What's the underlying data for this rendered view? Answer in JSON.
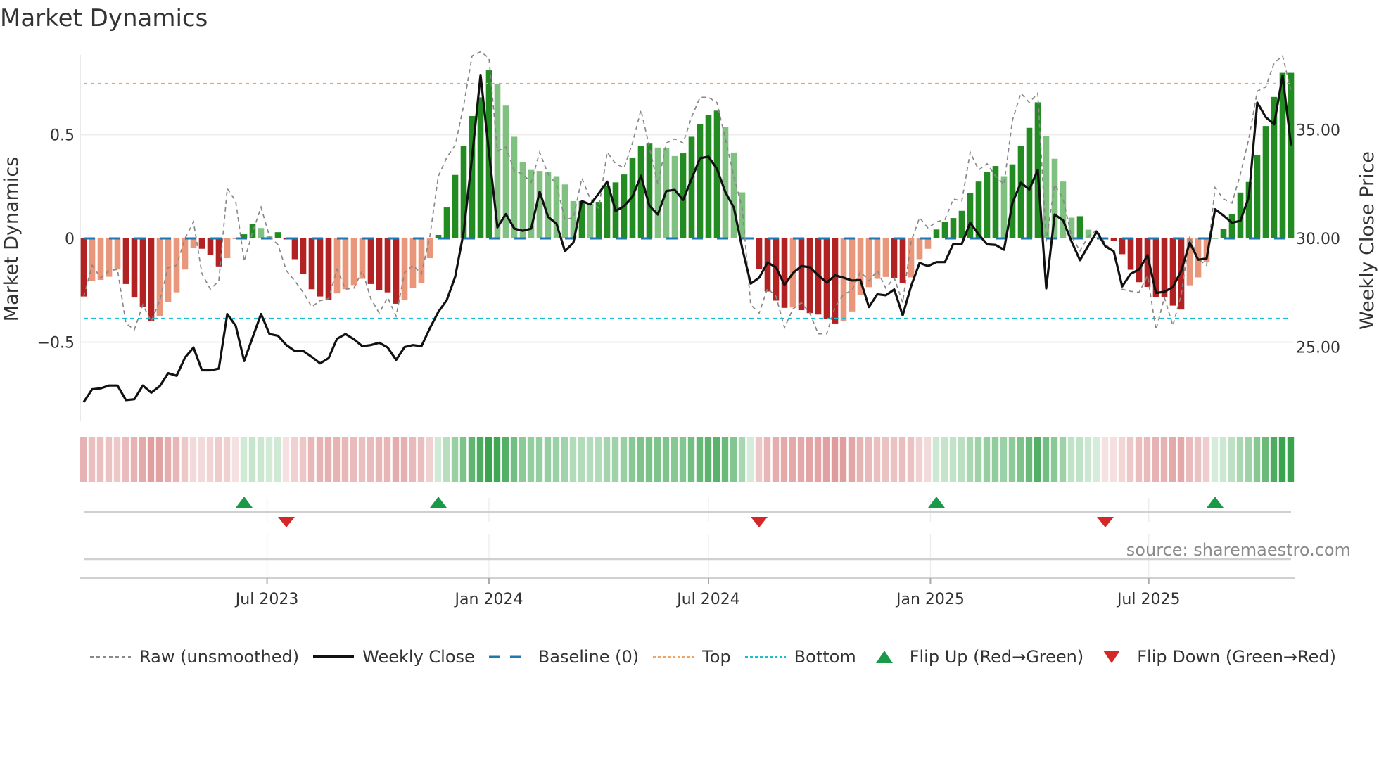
{
  "title": "Market Dynamics",
  "source": "source: sharemaestro.com",
  "colors": {
    "dark_green": "#228b22",
    "light_green": "#80c080",
    "dark_red": "#b22222",
    "light_red": "#e9967a",
    "raw": "#888888",
    "close": "#111111",
    "baseline": "#1f77b4",
    "top": "#f4a460",
    "bottom": "#17becf",
    "flip_up": "#1a9a48",
    "flip_down": "#d62728"
  },
  "legend": [
    {
      "key": "raw",
      "label": "Raw (unsmoothed)"
    },
    {
      "key": "close",
      "label": "Weekly Close"
    },
    {
      "key": "baseline",
      "label": "Baseline (0)"
    },
    {
      "key": "top",
      "label": "Top"
    },
    {
      "key": "bottom",
      "label": "Bottom"
    },
    {
      "key": "flip_up",
      "label": "Flip Up (Red→Green)"
    },
    {
      "key": "flip_down",
      "label": "Flip Down (Green→Red)"
    }
  ],
  "chart_data": {
    "type": "bar",
    "title": "Market Dynamics",
    "ylabel": "Market Dynamics",
    "y2label": "Weekly Close Price",
    "x_start": "2023-01-30",
    "x_step_days": 7,
    "x_ticks": [
      {
        "label": "Jul 2023",
        "date": "2023-07-01"
      },
      {
        "label": "Jan 2024",
        "date": "2024-01-01"
      },
      {
        "label": "Jul 2024",
        "date": "2024-07-01"
      },
      {
        "label": "Jan 2025",
        "date": "2025-01-01"
      },
      {
        "label": "Jul 2025",
        "date": "2025-07-01"
      }
    ],
    "ylim": [
      -0.88,
      0.89
    ],
    "y_ticks": [
      {
        "value": 0.5,
        "label": "0.5"
      },
      {
        "value": 0,
        "label": "0"
      },
      {
        "value": -0.5,
        "label": "−0.5"
      }
    ],
    "y2_ticks": [
      {
        "value": 35,
        "label": "35.00"
      },
      {
        "value": 30,
        "label": "30.00"
      },
      {
        "value": 25,
        "label": "25.00"
      }
    ],
    "baseline": 0,
    "top": 0.746,
    "bottom": -0.386,
    "values": [
      -0.28,
      -0.205,
      -0.2,
      -0.185,
      -0.15,
      -0.22,
      -0.285,
      -0.33,
      -0.4,
      -0.375,
      -0.305,
      -0.26,
      -0.15,
      -0.045,
      -0.05,
      -0.08,
      -0.135,
      -0.095,
      -0.003,
      0.02,
      0.07,
      0.05,
      0.01,
      0.03,
      -0.005,
      -0.1,
      -0.17,
      -0.245,
      -0.28,
      -0.295,
      -0.265,
      -0.245,
      -0.225,
      -0.195,
      -0.22,
      -0.25,
      -0.26,
      -0.315,
      -0.295,
      -0.24,
      -0.215,
      -0.095,
      0.017,
      0.149,
      0.306,
      0.446,
      0.59,
      0.68,
      0.81,
      0.746,
      0.64,
      0.49,
      0.368,
      0.33,
      0.325,
      0.32,
      0.3,
      0.26,
      0.18,
      0.18,
      0.167,
      0.176,
      0.252,
      0.27,
      0.308,
      0.39,
      0.444,
      0.457,
      0.438,
      0.435,
      0.397,
      0.41,
      0.49,
      0.55,
      0.596,
      0.616,
      0.536,
      0.414,
      0.222,
      0.005,
      -0.149,
      -0.256,
      -0.3,
      -0.335,
      -0.333,
      -0.346,
      -0.36,
      -0.367,
      -0.39,
      -0.41,
      -0.4,
      -0.352,
      -0.273,
      -0.235,
      -0.195,
      -0.186,
      -0.19,
      -0.214,
      -0.188,
      -0.1,
      -0.05,
      0.043,
      0.079,
      0.098,
      0.133,
      0.218,
      0.274,
      0.32,
      0.349,
      0.3,
      0.357,
      0.446,
      0.533,
      0.656,
      0.494,
      0.384,
      0.274,
      0.1,
      0.107,
      0.042,
      0.005,
      -0.005,
      -0.011,
      -0.076,
      -0.151,
      -0.211,
      -0.234,
      -0.284,
      -0.284,
      -0.324,
      -0.343,
      -0.226,
      -0.188,
      -0.115,
      0.002,
      0.046,
      0.116,
      0.221,
      0.272,
      0.403,
      0.542,
      0.682,
      0.798,
      0.798
    ],
    "raw": [
      -0.28,
      -0.13,
      -0.19,
      -0.155,
      -0.15,
      -0.41,
      -0.44,
      -0.32,
      -0.4,
      -0.3,
      -0.14,
      -0.13,
      0.0,
      0.08,
      -0.17,
      -0.245,
      -0.205,
      0.24,
      0.18,
      -0.11,
      0.03,
      0.15,
      0.01,
      -0.03,
      -0.155,
      -0.205,
      -0.26,
      -0.33,
      -0.3,
      -0.29,
      -0.15,
      -0.245,
      -0.24,
      -0.155,
      -0.29,
      -0.36,
      -0.285,
      -0.375,
      -0.165,
      -0.13,
      -0.17,
      0.01,
      0.3,
      0.39,
      0.45,
      0.64,
      0.88,
      0.9,
      0.87,
      0.42,
      0.44,
      0.325,
      0.31,
      0.27,
      0.415,
      0.31,
      0.26,
      0.09,
      0.1,
      0.29,
      0.19,
      0.145,
      0.415,
      0.36,
      0.34,
      0.46,
      0.62,
      0.44,
      0.26,
      0.46,
      0.48,
      0.46,
      0.585,
      0.68,
      0.68,
      0.655,
      0.48,
      0.3,
      0.145,
      -0.32,
      -0.36,
      -0.24,
      -0.28,
      -0.43,
      -0.34,
      -0.31,
      -0.36,
      -0.46,
      -0.46,
      -0.33,
      -0.27,
      -0.25,
      -0.16,
      -0.205,
      -0.155,
      -0.24,
      -0.19,
      -0.31,
      -0.015,
      0.1,
      0.05,
      0.08,
      0.09,
      0.19,
      0.18,
      0.415,
      0.33,
      0.36,
      0.3,
      0.26,
      0.57,
      0.7,
      0.655,
      0.7,
      -0.015,
      0.26,
      0.19,
      0.01,
      -0.06,
      0.01,
      0.04,
      -0.025,
      -0.07,
      -0.245,
      -0.255,
      -0.26,
      -0.18,
      -0.44,
      -0.285,
      -0.42,
      -0.27,
      0.01,
      -0.1,
      -0.13,
      0.245,
      0.19,
      0.17,
      0.31,
      0.48,
      0.71,
      0.73,
      0.845,
      0.88,
      0.71
    ],
    "close": [
      22.47,
      23.06,
      23.1,
      23.23,
      23.23,
      22.56,
      22.6,
      23.23,
      22.9,
      23.2,
      23.8,
      23.68,
      24.52,
      24.98,
      23.93,
      23.93,
      24.01,
      26.52,
      25.98,
      24.36,
      25.44,
      26.52,
      25.6,
      25.52,
      25.09,
      24.82,
      24.82,
      24.55,
      24.25,
      24.49,
      25.38,
      25.6,
      25.36,
      25.04,
      25.09,
      25.2,
      24.98,
      24.41,
      25.0,
      25.09,
      25.04,
      25.87,
      26.62,
      27.16,
      28.24,
      30.29,
      33.74,
      37.52,
      33.96,
      30.51,
      31.12,
      30.45,
      30.35,
      30.45,
      32.15,
      30.99,
      30.67,
      29.41,
      29.81,
      31.72,
      31.56,
      32.07,
      32.61,
      31.26,
      31.48,
      31.93,
      32.88,
      31.5,
      31.1,
      32.18,
      32.23,
      31.77,
      32.74,
      33.69,
      33.76,
      33.2,
      32.13,
      31.42,
      29.54,
      27.92,
      28.19,
      28.89,
      28.67,
      27.86,
      28.4,
      28.73,
      28.67,
      28.3,
      27.97,
      28.3,
      28.19,
      28.06,
      28.08,
      26.84,
      27.43,
      27.38,
      27.65,
      26.46,
      27.81,
      28.87,
      28.73,
      28.91,
      28.91,
      29.75,
      29.75,
      30.72,
      30.18,
      29.73,
      29.7,
      29.48,
      31.64,
      32.56,
      32.25,
      33.15,
      27.7,
      31.1,
      30.83,
      29.86,
      29.0,
      29.67,
      30.31,
      29.64,
      29.41,
      27.79,
      28.37,
      28.57,
      29.23,
      27.49,
      27.54,
      27.76,
      28.51,
      29.81,
      29.02,
      29.08,
      31.34,
      31.05,
      30.72,
      30.81,
      31.91,
      36.25,
      35.58,
      35.25,
      37.5,
      34.28
    ]
  }
}
